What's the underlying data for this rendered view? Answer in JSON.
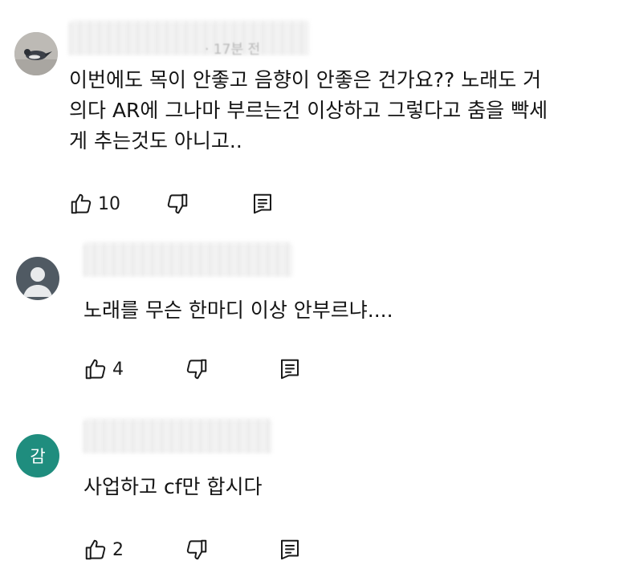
{
  "comments": [
    {
      "avatar": "photo-avatar",
      "meta": "· 17분 전",
      "text": "이번에도 목이 안좋고 음향이 안좋은 건가요?? 노래도 거\n의다 AR에 그나마 부르는건 이상하고 그렇다고 춤을 빡세\n게 추는것도 아니고..",
      "likes": "10"
    },
    {
      "avatar": "default-person-avatar",
      "meta": "",
      "text": "노래를 무슨 한마디 이상 안부르냐....",
      "likes": "4"
    },
    {
      "avatar": "letter-avatar",
      "avatar_letter": "감",
      "avatar_color": "#1f8d7e",
      "meta": "",
      "text": "사업하고 cf만 합시다",
      "likes": "2"
    }
  ],
  "icons": {
    "like": "thumbs-up-icon",
    "dislike": "thumbs-down-icon",
    "reply": "reply-icon"
  }
}
